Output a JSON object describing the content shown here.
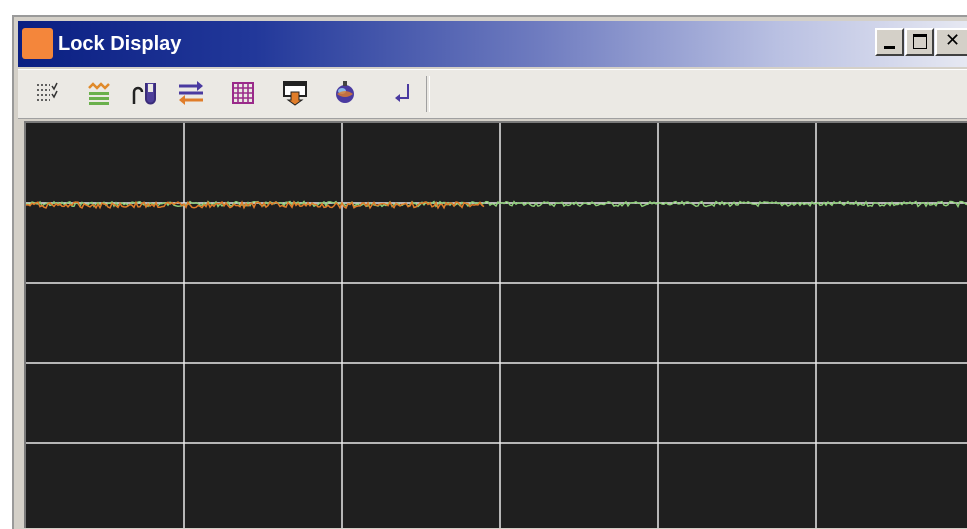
{
  "window": {
    "title": "Lock Display",
    "title_icon_color": "#f4863b"
  },
  "caption_buttons": [
    {
      "name": "minimize-button",
      "icon": "minimize-icon"
    },
    {
      "name": "maximize-button",
      "icon": "maximize-icon"
    },
    {
      "name": "close-button",
      "icon": "close-icon"
    }
  ],
  "toolbar": {
    "items": [
      {
        "name": "list-settings-icon"
      },
      {
        "name": "trace-display-icon"
      },
      {
        "name": "sample-tube-icon"
      },
      {
        "name": "swap-arrows-icon"
      },
      {
        "name": "grid-icon"
      },
      {
        "name": "window-download-icon"
      },
      {
        "name": "globe-icon"
      },
      {
        "name": "return-arrow-icon"
      }
    ]
  },
  "plot": {
    "background": "#1f1f1f",
    "grid_color": "#e8e8e8",
    "vertical_divisions": 6,
    "horizontal_divisions": 5,
    "trace_colors": {
      "primary": "#e07d2a",
      "secondary": "#8fd07a"
    }
  }
}
